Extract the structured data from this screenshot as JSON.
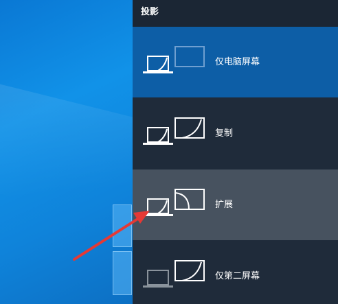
{
  "panel": {
    "title": "投影",
    "options": [
      {
        "label": "仅电脑屏幕",
        "icon": "pc-screen-only-icon"
      },
      {
        "label": "复制",
        "icon": "duplicate-icon"
      },
      {
        "label": "扩展",
        "icon": "extend-icon"
      },
      {
        "label": "仅第二屏幕",
        "icon": "second-screen-only-icon"
      }
    ],
    "colors": {
      "selected": "#0d5ea6",
      "hover": "#47525f",
      "background": "#1f2b3a",
      "arrow": "#e53935"
    }
  }
}
